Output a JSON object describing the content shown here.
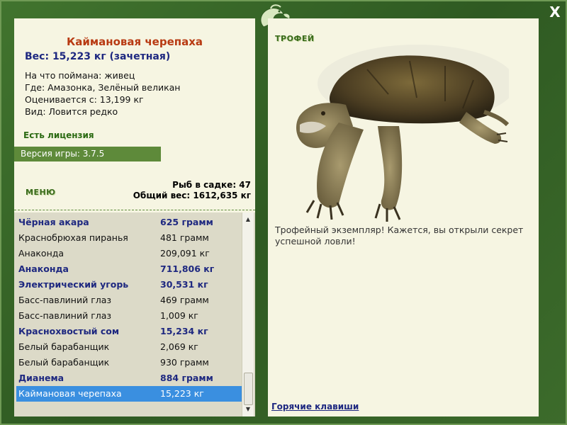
{
  "window": {
    "close_glyph": "X"
  },
  "fish": {
    "title": "Каймановая черепаха",
    "weight": "Вес: 15,223 кг (зачетная)",
    "info": [
      "На что поймана: живец",
      "Где: Амазонка, Зелёный великан",
      "Оценивается с: 13,199 кг",
      "Вид: Ловится редко"
    ]
  },
  "license": "Есть лицензия",
  "version": "Версия игры: 3.7.5",
  "menu": "МЕНЮ",
  "stats": {
    "fish_count": "Рыб в садке: 47",
    "total_weight": "Общий вес: 1612,635 кг"
  },
  "catch_list": [
    {
      "name": "Чёрная акара",
      "weight": "625 грамм",
      "bold": true
    },
    {
      "name": "Краснобрюхая пиранья",
      "weight": "481 грамм",
      "bold": false
    },
    {
      "name": "Анаконда",
      "weight": "209,091 кг",
      "bold": false
    },
    {
      "name": "Анаконда",
      "weight": "711,806 кг",
      "bold": true
    },
    {
      "name": "Электрический угорь",
      "weight": "30,531 кг",
      "bold": true
    },
    {
      "name": "Басс-павлиний глаз",
      "weight": "469 грамм",
      "bold": false
    },
    {
      "name": "Басс-павлиний глаз",
      "weight": "1,009 кг",
      "bold": false
    },
    {
      "name": "Краснохвостый сом",
      "weight": "15,234 кг",
      "bold": true
    },
    {
      "name": "Белый барабанщик",
      "weight": "2,069 кг",
      "bold": false
    },
    {
      "name": "Белый барабанщик",
      "weight": "930 грамм",
      "bold": false
    },
    {
      "name": "Дианема",
      "weight": "884 грамм",
      "bold": true
    },
    {
      "name": "Каймановая черепаха",
      "weight": "15,223 кг",
      "bold": false,
      "selected": true
    }
  ],
  "trophy": {
    "label": "ТРОФЕЙ",
    "description": "Трофейный экземпляр! Кажется, вы открыли секрет успешной ловли!"
  },
  "hotkeys": "Горячие клавиши",
  "colors": {
    "frame_green": "#3e6e2c",
    "title_red": "#b83a12",
    "highlight_blue": "#3a8fe0",
    "bold_blue": "#1e2880"
  }
}
